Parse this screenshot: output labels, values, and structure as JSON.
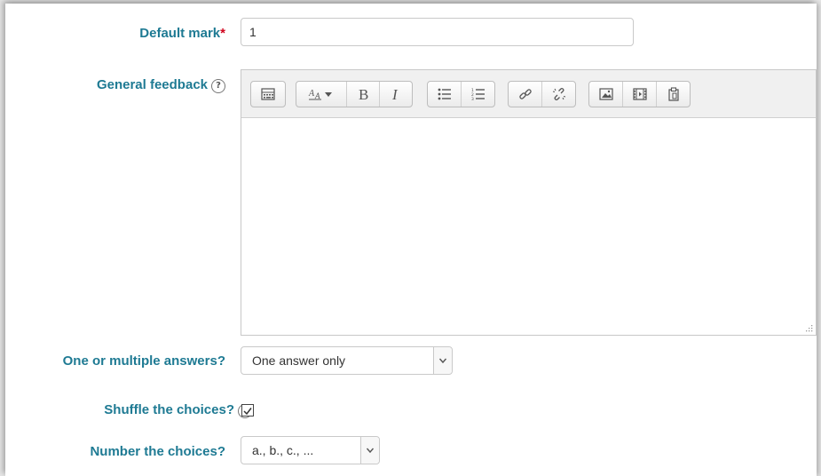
{
  "fields": {
    "default_mark": {
      "label": "Default mark",
      "required_marker": "*",
      "value": "1"
    },
    "general_feedback": {
      "label": "General feedback",
      "help_icon": "question-circle-icon"
    },
    "single_answer": {
      "label": "One or multiple answers?",
      "selected": "One answer only"
    },
    "shuffle": {
      "label": "Shuffle the choices?",
      "help_icon": "question-circle-icon",
      "checked": true
    },
    "numbering": {
      "label": "Number the choices?",
      "selected": "a., b., c., ..."
    }
  },
  "toolbar": {
    "groups": [
      [
        "show-more-buttons-icon"
      ],
      [
        "font-size-icon",
        "bold-icon",
        "italic-icon"
      ],
      [
        "unordered-list-icon",
        "ordered-list-icon"
      ],
      [
        "link-icon",
        "unlink-icon"
      ],
      [
        "image-icon",
        "media-icon",
        "paste-icon"
      ]
    ]
  },
  "colors": {
    "label": "#1e7a93",
    "required": "#d0021b"
  }
}
